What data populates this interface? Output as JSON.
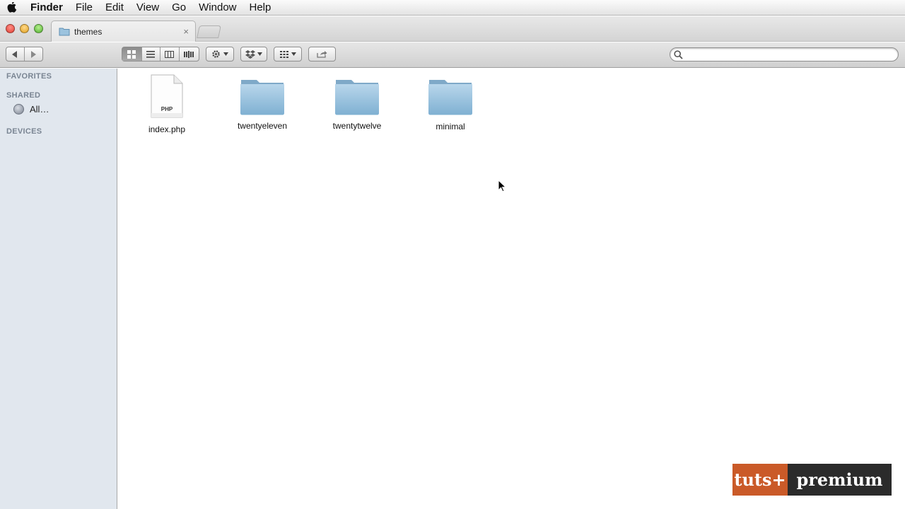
{
  "menubar": {
    "app_name": "Finder",
    "items": [
      "File",
      "Edit",
      "View",
      "Go",
      "Window",
      "Help"
    ]
  },
  "window": {
    "tab_title": "themes",
    "tab_close": "×"
  },
  "toolbar": {
    "search_placeholder": ""
  },
  "sidebar": {
    "favorites_header": "FAVORITES",
    "shared_header": "SHARED",
    "shared_items": [
      {
        "label": "All…"
      }
    ],
    "devices_header": "DEVICES"
  },
  "content": {
    "items": [
      {
        "name": "index.php",
        "kind": "file",
        "badge": "PHP"
      },
      {
        "name": "twentyeleven",
        "kind": "folder"
      },
      {
        "name": "twentytwelve",
        "kind": "folder"
      },
      {
        "name": "minimal",
        "kind": "folder"
      }
    ]
  },
  "watermark": {
    "left": "tuts+",
    "right": "premium"
  },
  "colors": {
    "sidebar_bg": "#e1e7ee",
    "folder_blue": "#8fb9d6",
    "watermark_orange": "#ca5a28"
  }
}
